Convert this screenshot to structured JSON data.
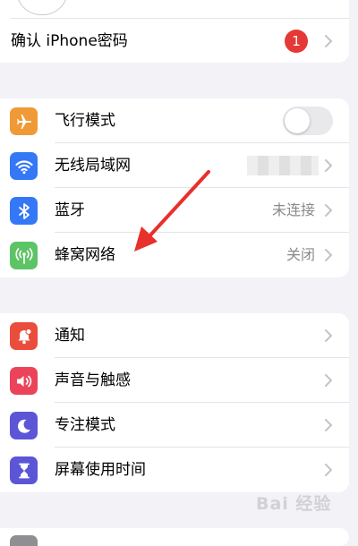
{
  "rows": {
    "confirm_password": {
      "label": "确认 iPhone密码",
      "badge": "1"
    },
    "airplane": {
      "label": "飞行模式",
      "toggle_on": false
    },
    "wifi": {
      "label": "无线局域网"
    },
    "bluetooth": {
      "label": "蓝牙",
      "value": "未连接"
    },
    "cellular": {
      "label": "蜂窝网络",
      "value": "关闭"
    },
    "notifications": {
      "label": "通知"
    },
    "sounds": {
      "label": "声音与触感"
    },
    "focus": {
      "label": "专注模式"
    },
    "screen_time": {
      "label": "屏幕使用时间"
    }
  },
  "watermark": "Bai 经验",
  "icons": {
    "airplane": "airplane-icon",
    "wifi": "wifi-icon",
    "bluetooth": "bluetooth-icon",
    "cellular": "cellular-antenna-icon",
    "notifications": "bell-icon",
    "sounds": "speaker-icon",
    "focus": "moon-icon",
    "screen_time": "hourglass-icon"
  },
  "colors": {
    "airplane": "#f09a37",
    "wifi": "#3478f6",
    "bluetooth": "#3478f6",
    "cellular": "#5dc466",
    "notifications": "#eb4d3d",
    "sounds": "#eb445a",
    "focus": "#5b56d6",
    "screen_time": "#5b56d6",
    "badge": "#e53935",
    "annotation_arrow": "#e8302c"
  }
}
